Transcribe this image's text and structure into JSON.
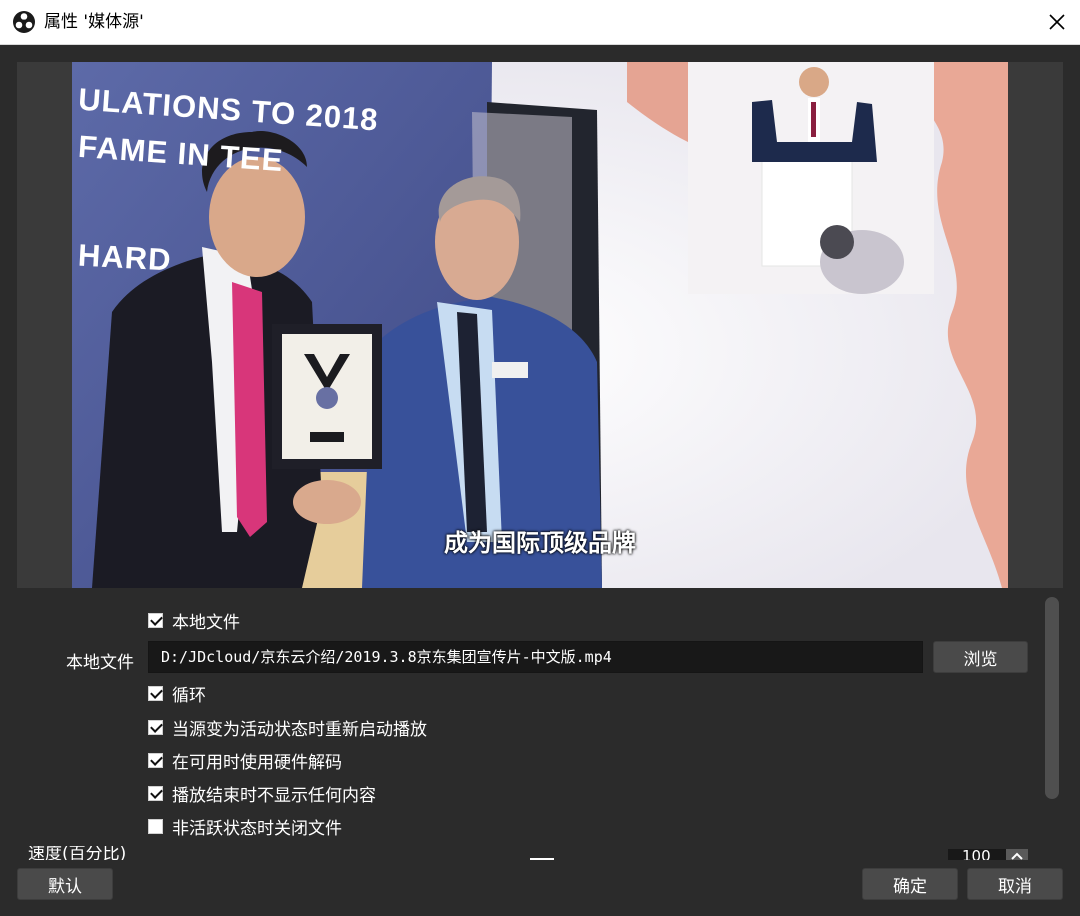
{
  "window": {
    "title": "属性 '媒体源'",
    "close_icon": "close-icon",
    "app_icon": "obs-logo-icon"
  },
  "preview": {
    "banner_line1": "ULATIONS TO 2018",
    "banner_line2": "FAME IN      TEE",
    "banner_line3": "HARD",
    "subtitle": "成为国际顶级品牌"
  },
  "properties": {
    "local_file_checkbox": {
      "label": "本地文件",
      "checked": true
    },
    "local_file_label": "本地文件",
    "local_file_path": "D:/JDcloud/京东云介绍/2019.3.8京东集团宣传片-中文版.mp4",
    "browse_label": "浏览",
    "options": [
      {
        "label": "循环",
        "checked": true
      },
      {
        "label": "当源变为活动状态时重新启动播放",
        "checked": true
      },
      {
        "label": "在可用时使用硬件解码",
        "checked": true
      },
      {
        "label": "播放结束时不显示任何内容",
        "checked": true
      },
      {
        "label": "非活跃状态时关闭文件",
        "checked": false
      }
    ],
    "speed_label_clipped": "速度(百分比)",
    "speed_value_clipped": "100"
  },
  "footer": {
    "defaults_label": "默认",
    "ok_label": "确定",
    "cancel_label": "取消"
  },
  "colors": {
    "dialog_bg": "#2b2b2b",
    "field_bg": "#181818",
    "button_bg": "#4a4a4a",
    "text": "#ffffff"
  }
}
